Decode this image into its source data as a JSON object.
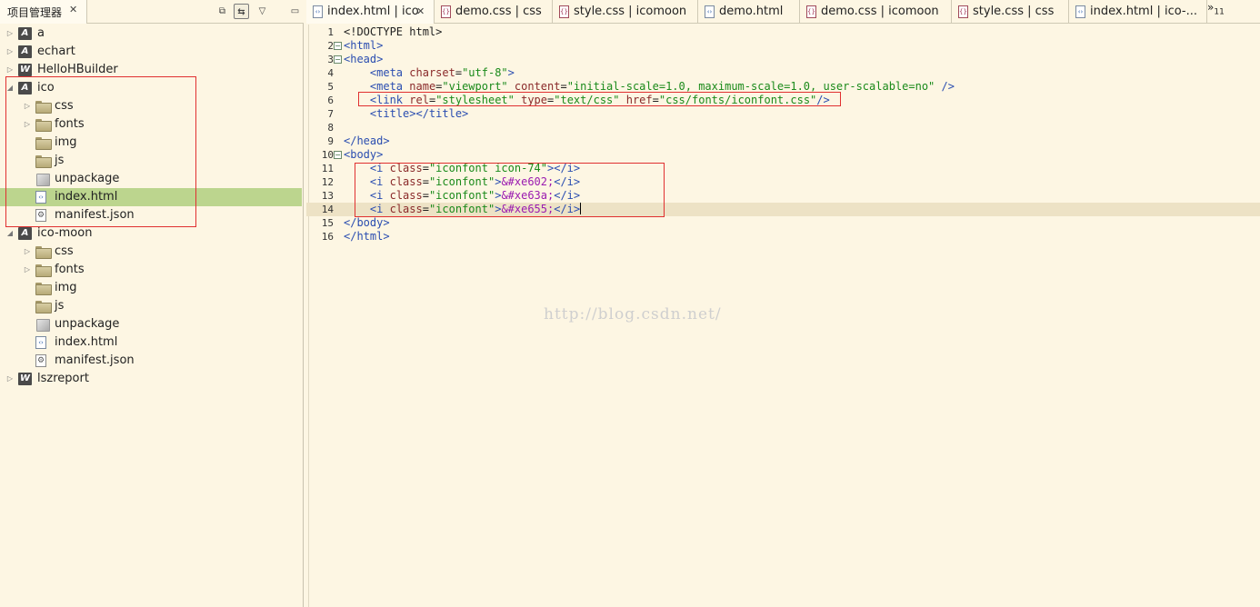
{
  "project_explorer": {
    "tab_title": "项目管理器",
    "close_glyph": "✕",
    "toolbar_icons": [
      "collapse-all-icon",
      "link-with-editor-icon",
      "view-menu-icon",
      "minimize-icon"
    ],
    "tree": [
      {
        "label": "a",
        "type": "project",
        "icon_letter": "A",
        "expanded": false,
        "depth": 0
      },
      {
        "label": "echart",
        "type": "project",
        "icon_letter": "A",
        "expanded": false,
        "depth": 0
      },
      {
        "label": "HelloHBuilder",
        "type": "project",
        "icon_letter": "W",
        "expanded": false,
        "depth": 0
      },
      {
        "label": "ico",
        "type": "project",
        "icon_letter": "A",
        "expanded": true,
        "depth": 0
      },
      {
        "label": "css",
        "type": "folder",
        "expandable": true,
        "depth": 1
      },
      {
        "label": "fonts",
        "type": "folder",
        "expandable": true,
        "depth": 1
      },
      {
        "label": "img",
        "type": "folder",
        "expandable": false,
        "depth": 1
      },
      {
        "label": "js",
        "type": "folder",
        "expandable": false,
        "depth": 1
      },
      {
        "label": "unpackage",
        "type": "package",
        "expandable": false,
        "depth": 1
      },
      {
        "label": "index.html",
        "type": "html",
        "expandable": false,
        "depth": 1,
        "selected": true
      },
      {
        "label": "manifest.json",
        "type": "json",
        "expandable": false,
        "depth": 1
      },
      {
        "label": "ico-moon",
        "type": "project",
        "icon_letter": "A",
        "expanded": true,
        "depth": 0
      },
      {
        "label": "css",
        "type": "folder",
        "expandable": true,
        "depth": 1
      },
      {
        "label": "fonts",
        "type": "folder",
        "expandable": true,
        "depth": 1
      },
      {
        "label": "img",
        "type": "folder",
        "expandable": false,
        "depth": 1
      },
      {
        "label": "js",
        "type": "folder",
        "expandable": false,
        "depth": 1
      },
      {
        "label": "unpackage",
        "type": "package",
        "expandable": false,
        "depth": 1
      },
      {
        "label": "index.html",
        "type": "html",
        "expandable": false,
        "depth": 1
      },
      {
        "label": "manifest.json",
        "type": "json",
        "expandable": false,
        "depth": 1
      },
      {
        "label": "lszreport",
        "type": "project",
        "icon_letter": "W",
        "expanded": false,
        "depth": 0
      }
    ]
  },
  "editor_tabs": [
    {
      "label": "index.html | ico",
      "kind": "html",
      "active": true,
      "closable": true
    },
    {
      "label": "demo.css | css",
      "kind": "css"
    },
    {
      "label": "style.css | icomoon",
      "kind": "css"
    },
    {
      "label": "demo.html",
      "kind": "html"
    },
    {
      "label": "demo.css | icomoon",
      "kind": "css"
    },
    {
      "label": "style.css | css",
      "kind": "css"
    },
    {
      "label": "index.html | ico-...",
      "kind": "html"
    }
  ],
  "tab_overflow": {
    "glyph": "»",
    "count": "11"
  },
  "code_lines": [
    {
      "n": "1",
      "fold": false,
      "current": false,
      "tokens": [
        [
          "p",
          "<!DOCTYPE html>"
        ]
      ]
    },
    {
      "n": "2",
      "fold": true,
      "current": false,
      "tokens": [
        [
          "t",
          "<html>"
        ]
      ]
    },
    {
      "n": "3",
      "fold": true,
      "current": false,
      "tokens": [
        [
          "t",
          "<head>"
        ]
      ]
    },
    {
      "n": "4",
      "fold": false,
      "current": false,
      "tokens": [
        [
          "p",
          "    "
        ],
        [
          "t",
          "<meta "
        ],
        [
          "a",
          "charset"
        ],
        [
          "p",
          "="
        ],
        [
          "v",
          "\"utf-8\""
        ],
        [
          "t",
          ">"
        ]
      ]
    },
    {
      "n": "5",
      "fold": false,
      "current": false,
      "tokens": [
        [
          "p",
          "    "
        ],
        [
          "t",
          "<meta "
        ],
        [
          "a",
          "name"
        ],
        [
          "p",
          "="
        ],
        [
          "v",
          "\"viewport\" "
        ],
        [
          "a",
          "content"
        ],
        [
          "p",
          "="
        ],
        [
          "v",
          "\"initial-scale=1.0, maximum-scale=1.0, user-scalable=no\" "
        ],
        [
          "t",
          "/>"
        ]
      ]
    },
    {
      "n": "6",
      "fold": false,
      "current": false,
      "tokens": [
        [
          "p",
          "    "
        ],
        [
          "t",
          "<link "
        ],
        [
          "a",
          "rel"
        ],
        [
          "p",
          "="
        ],
        [
          "v",
          "\"stylesheet\" "
        ],
        [
          "a",
          "type"
        ],
        [
          "p",
          "="
        ],
        [
          "v",
          "\"text/css\" "
        ],
        [
          "a",
          "href"
        ],
        [
          "p",
          "="
        ],
        [
          "v",
          "\"css/fonts/iconfont.css\""
        ],
        [
          "t",
          "/>"
        ]
      ]
    },
    {
      "n": "7",
      "fold": false,
      "current": false,
      "tokens": [
        [
          "p",
          "    "
        ],
        [
          "t",
          "<title></title>"
        ]
      ]
    },
    {
      "n": "8",
      "fold": false,
      "current": false,
      "tokens": []
    },
    {
      "n": "9",
      "fold": false,
      "current": false,
      "tokens": [
        [
          "t",
          "</head>"
        ]
      ]
    },
    {
      "n": "10",
      "fold": true,
      "current": false,
      "tokens": [
        [
          "t",
          "<body>"
        ]
      ]
    },
    {
      "n": "11",
      "fold": false,
      "current": false,
      "tokens": [
        [
          "p",
          "    "
        ],
        [
          "t",
          "<i "
        ],
        [
          "a",
          "class"
        ],
        [
          "p",
          "="
        ],
        [
          "v",
          "\"iconfont icon-74\""
        ],
        [
          "t",
          "></i>"
        ]
      ]
    },
    {
      "n": "12",
      "fold": false,
      "current": false,
      "tokens": [
        [
          "p",
          "    "
        ],
        [
          "t",
          "<i "
        ],
        [
          "a",
          "class"
        ],
        [
          "p",
          "="
        ],
        [
          "v",
          "\"iconfont\""
        ],
        [
          "t",
          ">"
        ],
        [
          "e",
          "&#xe602;"
        ],
        [
          "t",
          "</i>"
        ]
      ]
    },
    {
      "n": "13",
      "fold": false,
      "current": false,
      "tokens": [
        [
          "p",
          "    "
        ],
        [
          "t",
          "<i "
        ],
        [
          "a",
          "class"
        ],
        [
          "p",
          "="
        ],
        [
          "v",
          "\"iconfont\""
        ],
        [
          "t",
          ">"
        ],
        [
          "e",
          "&#xe63a;"
        ],
        [
          "t",
          "</i>"
        ]
      ]
    },
    {
      "n": "14",
      "fold": false,
      "current": true,
      "caret_after": 7,
      "tokens": [
        [
          "p",
          "    "
        ],
        [
          "t",
          "<i "
        ],
        [
          "a",
          "class"
        ],
        [
          "p",
          "="
        ],
        [
          "v",
          "\"iconfont\""
        ],
        [
          "t",
          ">"
        ],
        [
          "e",
          "&#xe655;"
        ],
        [
          "t",
          "</i>"
        ]
      ]
    },
    {
      "n": "15",
      "fold": false,
      "current": false,
      "tokens": [
        [
          "t",
          "</body>"
        ]
      ]
    },
    {
      "n": "16",
      "fold": false,
      "current": false,
      "tokens": [
        [
          "t",
          "</html>"
        ]
      ]
    }
  ],
  "watermark": "http://blog.csdn.net/",
  "colors": {
    "background": "#fdf6e3",
    "selection": "#bcd58e",
    "current_line": "#ede2c5",
    "annotation_red": "#e03030",
    "tag_blue": "#2a4db0",
    "attr_brown": "#8a2a2a",
    "value_green": "#1a8a1a",
    "entity_purple": "#9a1ab0"
  }
}
